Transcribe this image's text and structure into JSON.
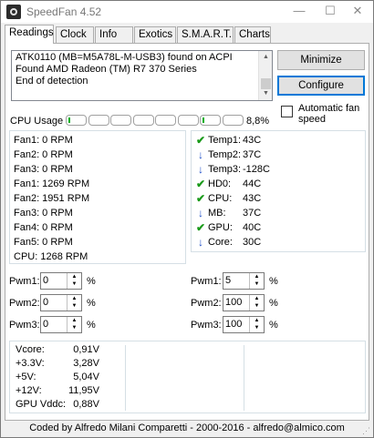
{
  "window": {
    "title": "SpeedFan 4.52",
    "controls": {
      "minimize": "—",
      "maximize": "☐",
      "close": "✕"
    }
  },
  "tabs": [
    "Readings",
    "Clock",
    "Info",
    "Exotics",
    "S.M.A.R.T.",
    "Charts"
  ],
  "active_tab": "Readings",
  "log": {
    "lines": [
      "ATK0110 (MB=M5A78L-M-USB3) found on ACPI",
      "Found AMD Radeon (TM) R7 370 Series",
      "End of detection"
    ]
  },
  "buttons": {
    "minimize": "Minimize",
    "configure": "Configure"
  },
  "auto_fan": {
    "label": "Automatic fan speed",
    "checked": false
  },
  "cpu_usage": {
    "label": "CPU Usage",
    "percent_text": "8,8%",
    "core_levels": [
      0.1,
      0,
      0,
      0,
      0,
      0,
      0.05,
      0
    ]
  },
  "fans": [
    "Fan1: 0 RPM",
    "Fan2: 0 RPM",
    "Fan3: 0 RPM",
    "Fan1: 1269 RPM",
    "Fan2: 1951 RPM",
    "Fan3: 0 RPM",
    "Fan4: 0 RPM",
    "Fan5: 0 RPM",
    "CPU: 1268 RPM"
  ],
  "temps": [
    {
      "label": "Temp1:",
      "value": "43C",
      "icon": "check-icon"
    },
    {
      "label": "Temp2:",
      "value": "37C",
      "icon": "arrow-down-icon"
    },
    {
      "label": "Temp3:",
      "value": "-128C",
      "icon": "arrow-down-icon"
    },
    {
      "label": "HD0:",
      "value": "44C",
      "icon": "check-icon"
    },
    {
      "label": "CPU:",
      "value": "43C",
      "icon": "check-icon"
    },
    {
      "label": "MB:",
      "value": "37C",
      "icon": "arrow-down-icon"
    },
    {
      "label": "GPU:",
      "value": "40C",
      "icon": "check-icon"
    },
    {
      "label": "Core:",
      "value": "30C",
      "icon": "arrow-down-icon"
    }
  ],
  "pwm_left": [
    {
      "label": "Pwm1:",
      "value": "0",
      "unit": "%"
    },
    {
      "label": "Pwm2:",
      "value": "0",
      "unit": "%"
    },
    {
      "label": "Pwm3:",
      "value": "0",
      "unit": "%"
    }
  ],
  "pwm_right": [
    {
      "label": "Pwm1:",
      "value": "5",
      "unit": "%"
    },
    {
      "label": "Pwm2:",
      "value": "100",
      "unit": "%"
    },
    {
      "label": "Pwm3:",
      "value": "100",
      "unit": "%"
    }
  ],
  "voltages": [
    {
      "label": "Vcore:",
      "value": "0,91V"
    },
    {
      "label": "+3.3V:",
      "value": "3,28V"
    },
    {
      "label": "+5V:",
      "value": "5,04V"
    },
    {
      "label": "+12V:",
      "value": "11,95V"
    },
    {
      "label": "GPU Vddc:",
      "value": "0,88V"
    }
  ],
  "status": "Coded by Alfredo Milani Comparetti - 2000-2016 - alfredo@almico.com",
  "colors": {
    "accent": "#0078d7",
    "ok": "#1a9a1a",
    "down": "#1f4fc8",
    "meter": "#06b025"
  }
}
